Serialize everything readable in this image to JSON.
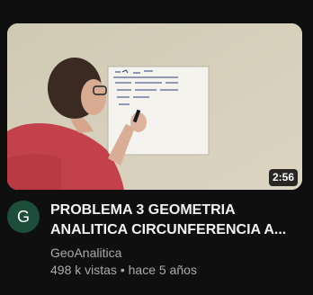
{
  "video": {
    "duration": "2:56",
    "title_line1": "PROBLEMA 3 GEOMETRIA",
    "title_line2": "ANALITICA CIRCUNFERENCIA A...",
    "channel": "GeoAnalitica",
    "views": "498 k vistas",
    "separator": "•",
    "age": "hace 5 años"
  },
  "avatar": {
    "letter": "G",
    "color": "#1d4e3b"
  },
  "colors": {
    "background": "#0f0f0f",
    "title": "#f1f1f1",
    "secondary": "#aaaaaa"
  }
}
